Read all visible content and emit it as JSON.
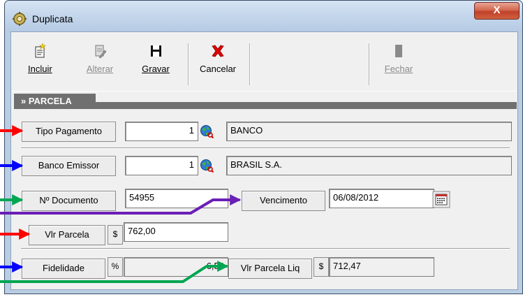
{
  "window": {
    "title": "Duplicata",
    "close_label": "X"
  },
  "toolbar": {
    "incluir": {
      "label": "Incluir",
      "icon": "new-document-icon",
      "enabled": true
    },
    "alterar": {
      "label": "Alterar",
      "icon": "edit-document-icon",
      "enabled": false
    },
    "gravar": {
      "label": "Gravar",
      "icon": "floppy-disk-icon",
      "enabled": true
    },
    "cancelar": {
      "label": "Cancelar",
      "icon": "red-x-icon",
      "enabled": true
    },
    "fechar": {
      "label": "Fechar",
      "icon": "door-icon",
      "enabled": false
    }
  },
  "section": {
    "title": "» PARCELA"
  },
  "fields": {
    "tipo_pagamento": {
      "label": "Tipo Pagamento",
      "code": "1",
      "description": "BANCO"
    },
    "banco_emissor": {
      "label": "Banco Emissor",
      "code": "1",
      "description": "BRASIL S.A."
    },
    "n_documento": {
      "label": "Nº Documento",
      "value": "54955"
    },
    "vencimento": {
      "label": "Vencimento",
      "value": "06/08/2012"
    },
    "vlr_parcela": {
      "label": "Vlr Parcela",
      "currency": "$",
      "value": "762,00"
    },
    "fidelidade": {
      "label": "Fidelidade",
      "unit": "%",
      "value": "6,50"
    },
    "vlr_parcela_liq": {
      "label": "Vlr Parcela Liq",
      "currency": "$",
      "value": "712,47"
    }
  },
  "annotation_colors": {
    "red": "#ff0000",
    "blue": "#0000ff",
    "green": "#00a651",
    "purple": "#6a1fb5"
  }
}
